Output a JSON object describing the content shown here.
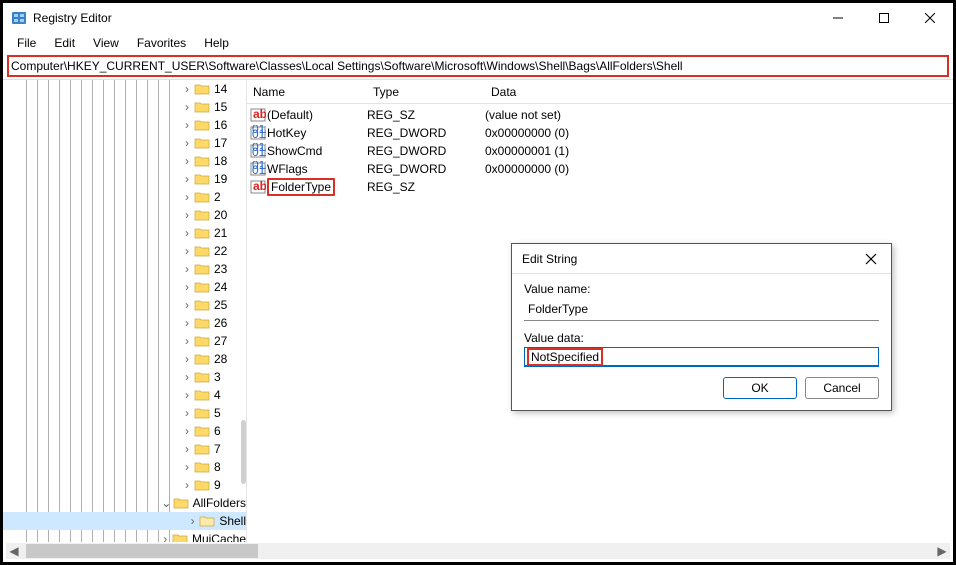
{
  "window": {
    "title": "Registry Editor"
  },
  "menu": {
    "file": "File",
    "edit": "Edit",
    "view": "View",
    "favorites": "Favorites",
    "help": "Help"
  },
  "address": "Computer\\HKEY_CURRENT_USER\\Software\\Classes\\Local Settings\\Software\\Microsoft\\Windows\\Shell\\Bags\\AllFolders\\Shell",
  "tree": {
    "items": [
      {
        "label": "14",
        "type": "num"
      },
      {
        "label": "15",
        "type": "num"
      },
      {
        "label": "16",
        "type": "num"
      },
      {
        "label": "17",
        "type": "num"
      },
      {
        "label": "18",
        "type": "num"
      },
      {
        "label": "19",
        "type": "num"
      },
      {
        "label": "2",
        "type": "num"
      },
      {
        "label": "20",
        "type": "num"
      },
      {
        "label": "21",
        "type": "num"
      },
      {
        "label": "22",
        "type": "num"
      },
      {
        "label": "23",
        "type": "num"
      },
      {
        "label": "24",
        "type": "num"
      },
      {
        "label": "25",
        "type": "num"
      },
      {
        "label": "26",
        "type": "num"
      },
      {
        "label": "27",
        "type": "num"
      },
      {
        "label": "28",
        "type": "num"
      },
      {
        "label": "3",
        "type": "num"
      },
      {
        "label": "4",
        "type": "num"
      },
      {
        "label": "5",
        "type": "num"
      },
      {
        "label": "6",
        "type": "num"
      },
      {
        "label": "7",
        "type": "num"
      },
      {
        "label": "8",
        "type": "num"
      },
      {
        "label": "9",
        "type": "num"
      },
      {
        "label": "AllFolders",
        "type": "allfolders"
      },
      {
        "label": "Shell",
        "type": "shell"
      },
      {
        "label": "MuiCache",
        "type": "mui"
      }
    ]
  },
  "columns": {
    "name": "Name",
    "type": "Type",
    "data": "Data"
  },
  "values": [
    {
      "icon": "sz",
      "name": "(Default)",
      "type": "REG_SZ",
      "data": "(value not set)"
    },
    {
      "icon": "bin",
      "name": "HotKey",
      "type": "REG_DWORD",
      "data": "0x00000000 (0)"
    },
    {
      "icon": "bin",
      "name": "ShowCmd",
      "type": "REG_DWORD",
      "data": "0x00000001 (1)"
    },
    {
      "icon": "bin",
      "name": "WFlags",
      "type": "REG_DWORD",
      "data": "0x00000000 (0)"
    },
    {
      "icon": "sz",
      "name": "FolderType",
      "type": "REG_SZ",
      "data": "",
      "highlight": true
    }
  ],
  "dialog": {
    "title": "Edit String",
    "name_label": "Value name:",
    "name_value": "FolderType",
    "data_label": "Value data:",
    "data_value": "NotSpecified",
    "ok": "OK",
    "cancel": "Cancel"
  }
}
